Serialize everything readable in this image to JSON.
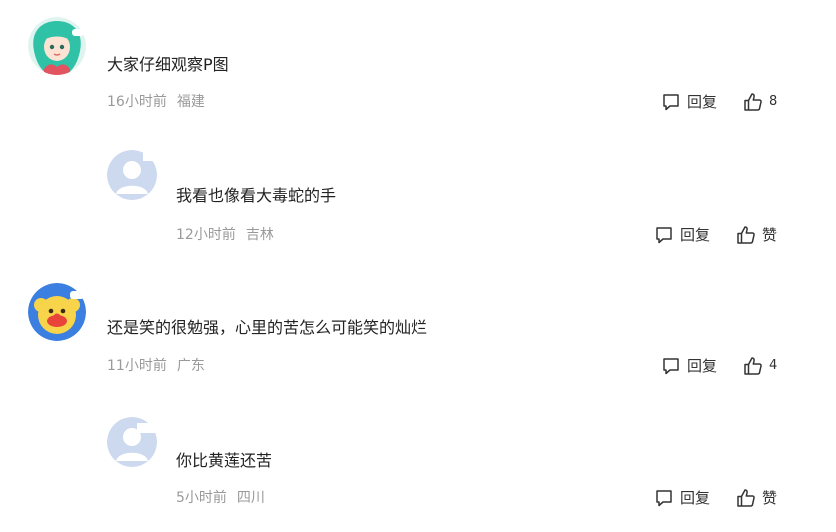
{
  "comments": [
    {
      "text": "大家仔细观察P图",
      "time": "16小时前",
      "location": "福建",
      "reply_label": "回复",
      "like_label": "8",
      "avatar_icon": "mermaid-avatar-icon"
    },
    {
      "text": "我看也像看大毒蛇的手",
      "time": "12小时前",
      "location": "吉林",
      "reply_label": "回复",
      "like_label": "赞",
      "avatar_icon": "default-user-avatar-icon"
    },
    {
      "text": "还是笑的很勉强，心里的苦怎么可能笑的灿烂",
      "time": "11小时前",
      "location": "广东",
      "reply_label": "回复",
      "like_label": "4",
      "avatar_icon": "clown-avatar-icon"
    },
    {
      "text": "你比黄莲还苦",
      "time": "5小时前",
      "location": "四川",
      "reply_label": "回复",
      "like_label": "赞",
      "avatar_icon": "default-user-avatar-icon"
    }
  ],
  "colors": {
    "text": "#222222",
    "meta": "#9a9a9a",
    "icon": "#333333",
    "default_avatar": "#cdd9ee"
  }
}
